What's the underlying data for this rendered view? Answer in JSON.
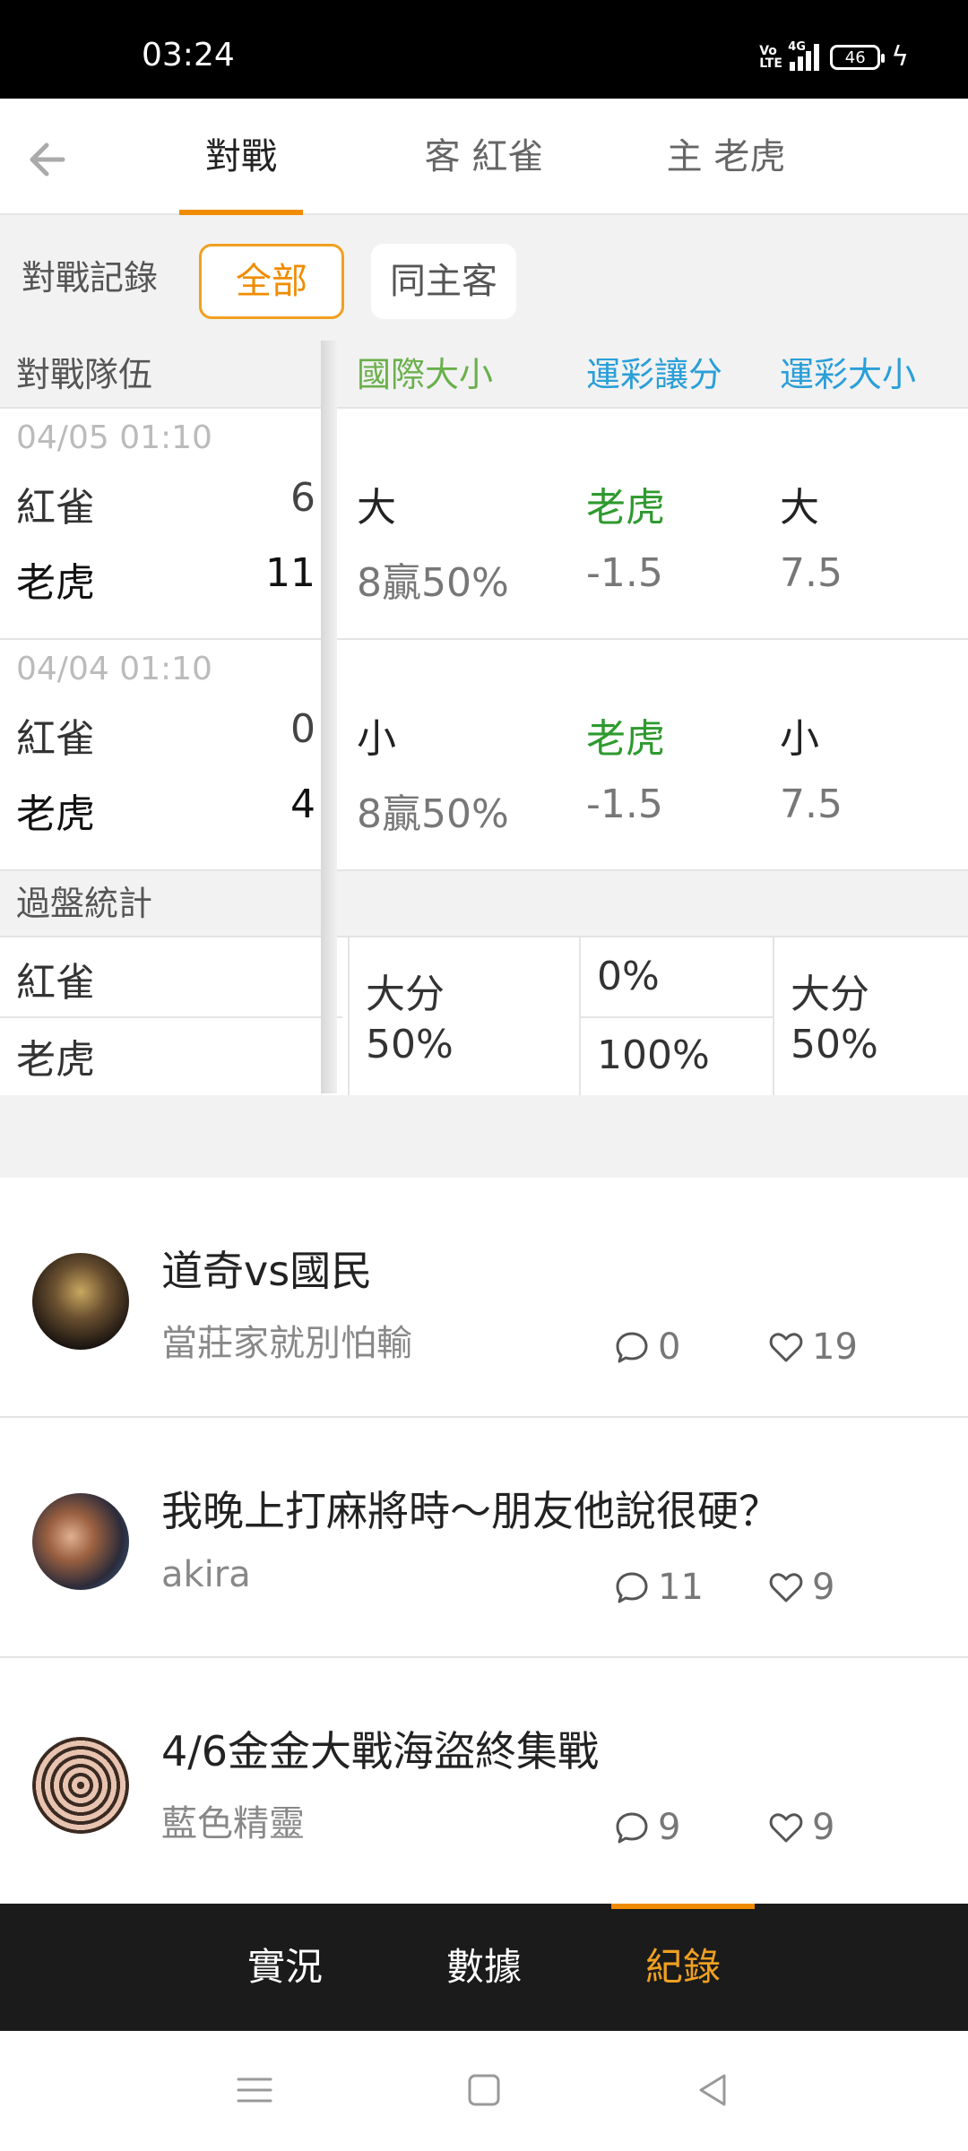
{
  "status_bar": {
    "time": "03:24",
    "volte": "Vo LTE",
    "network": "4G",
    "battery": "46"
  },
  "top_nav": {
    "tabs": [
      {
        "label": "對戰",
        "active": true
      },
      {
        "label": "客 紅雀",
        "active": false
      },
      {
        "label": "主 老虎",
        "active": false
      }
    ]
  },
  "filter": {
    "label": "對戰記錄",
    "chips": [
      {
        "label": "全部",
        "active": true
      },
      {
        "label": "同主客",
        "active": false
      }
    ]
  },
  "table": {
    "headers": {
      "teams": "對戰隊伍",
      "intl_total": "國際大小",
      "spread": "運彩讓分",
      "lottery_total": "運彩大小"
    },
    "header_colors": {
      "intl_total": "#6ab04c",
      "spread": "#2a9fd8",
      "lottery_total": "#2a9fd8"
    },
    "matches": [
      {
        "date": "04/05 01:10",
        "away": "紅雀",
        "away_score": "6",
        "home": "老虎",
        "home_score": "11",
        "intl_result": "大",
        "intl_rate": "8贏50%",
        "spread_result": "老虎",
        "spread_value": "-1.5",
        "lottery_result": "大",
        "lottery_value": "7.5"
      },
      {
        "date": "04/04 01:10",
        "away": "紅雀",
        "away_score": "0",
        "home": "老虎",
        "home_score": "4",
        "intl_result": "小",
        "intl_rate": "8贏50%",
        "spread_result": "老虎",
        "spread_value": "-1.5",
        "lottery_result": "小",
        "lottery_value": "7.5"
      }
    ],
    "stats": {
      "label": "過盤統計",
      "team1": "紅雀",
      "team2": "老虎",
      "intl_line1": "大分",
      "intl_line2": "50%",
      "spread_team1": "0%",
      "spread_team2": "100%",
      "lottery_line1": "大分",
      "lottery_line2": "50%"
    },
    "win_color": "#2e9a2e"
  },
  "posts": [
    {
      "title": "道奇vs國民",
      "author": "當莊家就別怕輸",
      "comments": "0",
      "likes": "19"
    },
    {
      "title": "我晚上打麻將時～朋友他說很硬？",
      "author": "akira",
      "comments": "11",
      "likes": "9"
    },
    {
      "title": "4/6金金大戰海盜終集戰",
      "author": "藍色精靈",
      "comments": "9",
      "likes": "9"
    }
  ],
  "bottom_nav": {
    "items": [
      {
        "label": "實況",
        "active": false
      },
      {
        "label": "數據",
        "active": false
      },
      {
        "label": "紀錄",
        "active": true
      }
    ]
  },
  "accent": "#f08c00"
}
